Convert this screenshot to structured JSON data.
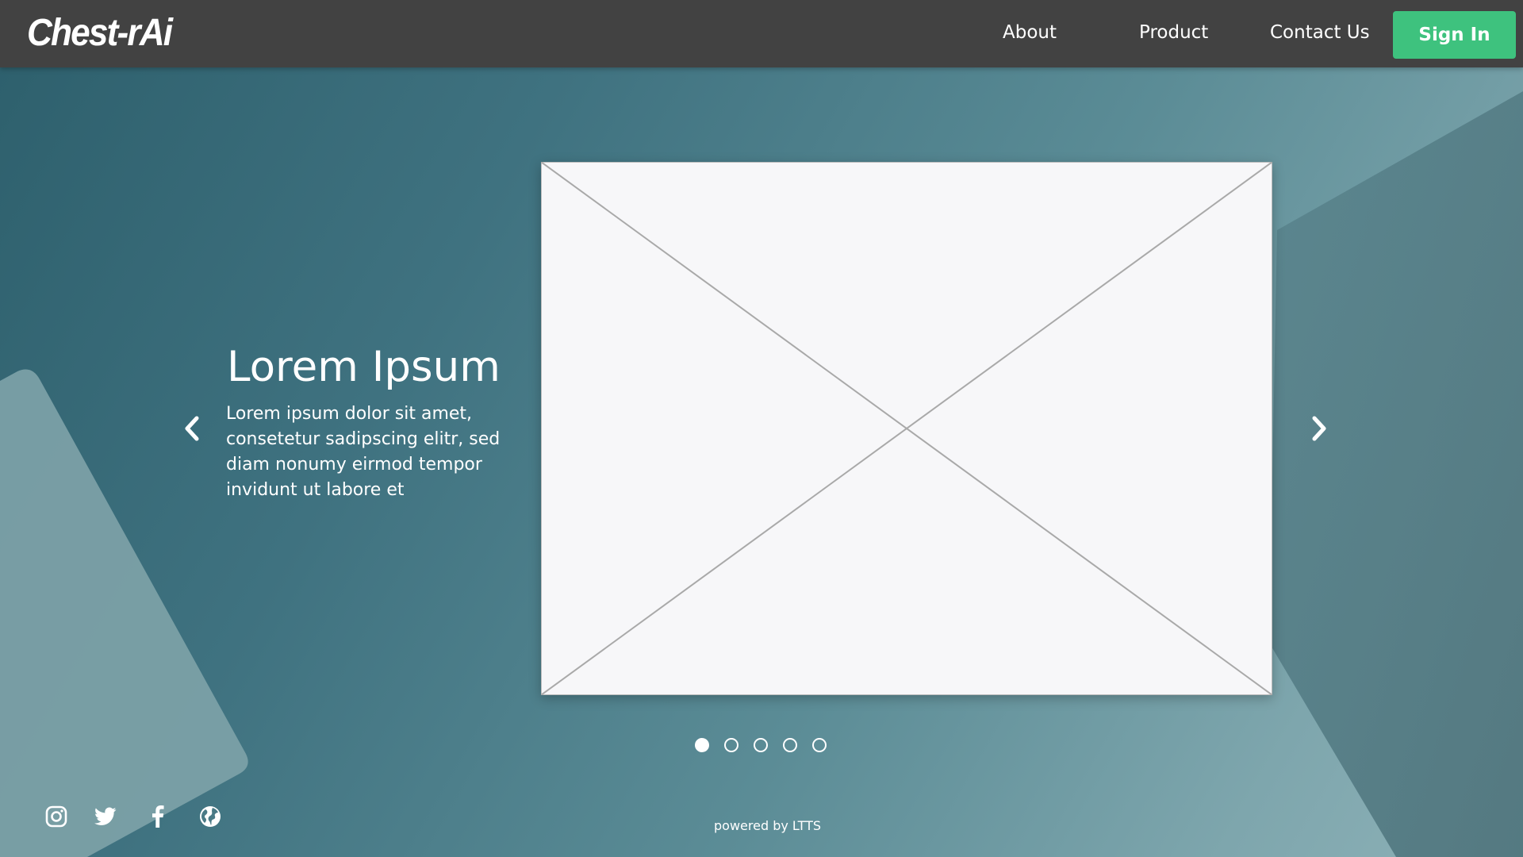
{
  "header": {
    "logo": "Chest-rAi",
    "nav": {
      "about": "About",
      "product": "Product",
      "contact": "Contact Us"
    },
    "sign_in": "Sign In"
  },
  "hero": {
    "title": "Lorem Ipsum",
    "text": "Lorem ipsum dolor sit amet, consetetur sadipscing elitr, sed diam nonumy eirmod tempor invidunt ut labore et"
  },
  "carousel": {
    "slide_count": 5,
    "active_slide": 1,
    "image_alt": "image-placeholder"
  },
  "social": [
    "instagram-icon",
    "twitter-icon",
    "facebook-icon",
    "globe-icon"
  ],
  "footer": {
    "powered_by": "powered by LTTS"
  },
  "colors": {
    "header_bg": "#424242",
    "accent": "#3ec27e",
    "hero_bg_dark": "#2d5f6c",
    "hero_bg_light": "#8eb2b8"
  }
}
